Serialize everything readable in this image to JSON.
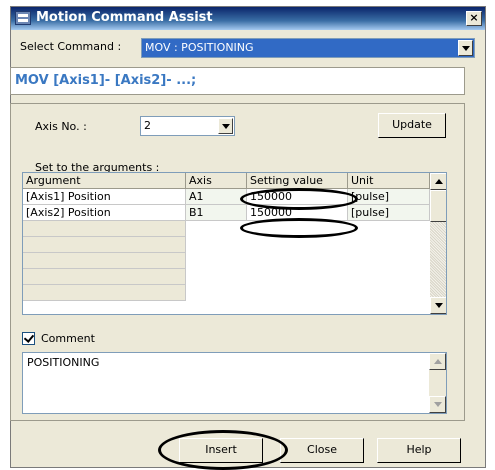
{
  "window": {
    "title": "Motion Command Assist",
    "close_symbol": "×"
  },
  "select_command": {
    "label": "Select Command :",
    "value": "MOV : POSITIONING"
  },
  "syntax_text": "MOV [Axis1]- [Axis2]- ...;",
  "axis": {
    "label": "Axis No. :",
    "value": "2"
  },
  "update_label": "Update",
  "arguments_label": "Set to the arguments :",
  "table": {
    "headers": [
      "Argument",
      "Axis",
      "Setting value",
      "Unit"
    ],
    "rows": [
      [
        "[Axis1] Position",
        "A1",
        "150000",
        "[pulse]"
      ],
      [
        "[Axis2] Position",
        "B1",
        "150000",
        "[pulse]"
      ]
    ]
  },
  "comment": {
    "label": "Comment",
    "checked": true,
    "text": "POSITIONING"
  },
  "buttons": {
    "insert": "Insert",
    "close": "Close",
    "help": "Help"
  },
  "icons": [
    "window-app-icon",
    "close-icon",
    "dropdown-arrow-icon",
    "scroll-up-icon",
    "scroll-down-icon",
    "checkbox-checked-icon"
  ],
  "colors": {
    "title_bar": "#0a246a",
    "syntax_text": "#3a78c2",
    "dialog_bg": "#ece9d8",
    "annotation": "#000000"
  }
}
